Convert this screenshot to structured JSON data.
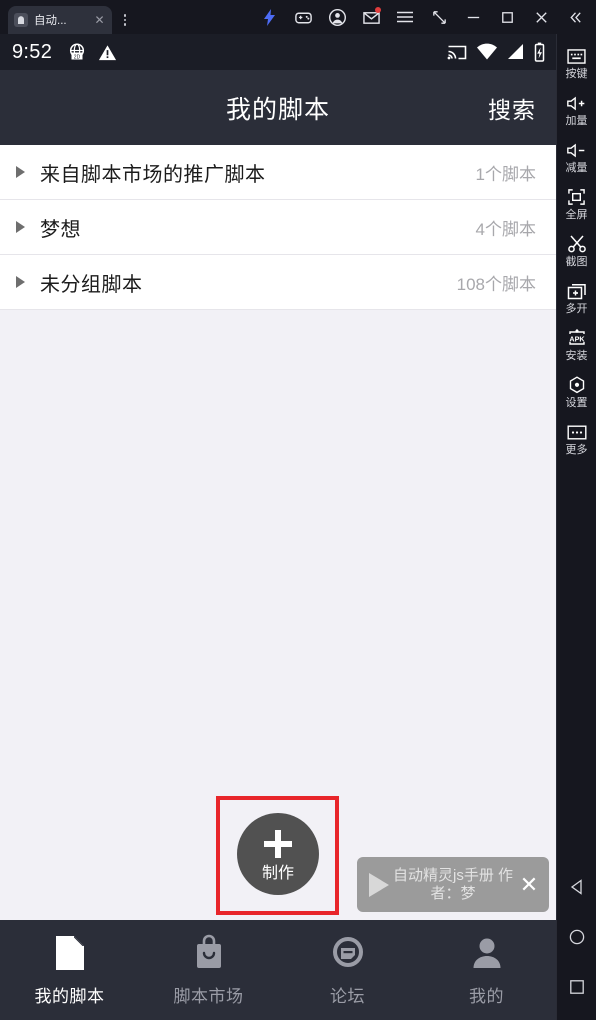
{
  "window": {
    "tab": {
      "title": "自动...",
      "icon": "app-favicon",
      "close_label": "✕"
    },
    "tab_menu_name": "tab-overflow-menu",
    "toolbar": [
      {
        "name": "boost-icon",
        "label": "加速"
      },
      {
        "name": "gamepad-icon",
        "label": "游戏手柄"
      },
      {
        "name": "account-icon",
        "label": "账号"
      },
      {
        "name": "mail-icon",
        "label": "消息",
        "badge": true
      },
      {
        "name": "menu-icon",
        "label": "菜单"
      },
      {
        "name": "resize-icon",
        "label": "调整大小"
      },
      {
        "name": "minimize-icon",
        "label": "最小化"
      },
      {
        "name": "maximize-icon",
        "label": "最大化"
      },
      {
        "name": "close-icon",
        "label": "关闭"
      },
      {
        "name": "collapse-icon",
        "label": "收起"
      }
    ]
  },
  "statusbar": {
    "time": "9:52",
    "left_icons": [
      "globe-2d-icon",
      "warning-triangle-icon"
    ],
    "right_icons": [
      "cast-icon",
      "wifi-icon",
      "signal-icon",
      "battery-charging-icon"
    ]
  },
  "header": {
    "title": "我的脚本",
    "search_label": "搜索"
  },
  "groups": [
    {
      "name": "来自脚本市场的推广脚本",
      "count": "1个脚本"
    },
    {
      "name": "梦想",
      "count": "4个脚本"
    },
    {
      "name": "未分组脚本",
      "count": "108个脚本"
    }
  ],
  "fab": {
    "label": "制作",
    "icon": "plus-icon",
    "highlight_color": "#e8252a",
    "background_color": "#515151"
  },
  "player": {
    "title": "自动精灵js手册 作者：梦",
    "play_icon": "play-icon",
    "close_label": "✕"
  },
  "bottom_nav": [
    {
      "label": "我的脚本",
      "icon": "document-icon",
      "active": true
    },
    {
      "label": "脚本市场",
      "icon": "shopping-bag-icon",
      "active": false
    },
    {
      "label": "论坛",
      "icon": "forum-icon",
      "active": false
    },
    {
      "label": "我的",
      "icon": "person-icon",
      "active": false
    }
  ],
  "sidebar": {
    "items": [
      {
        "label": "按键",
        "icon": "keyboard-icon"
      },
      {
        "label": "加量",
        "icon": "volume-up-icon"
      },
      {
        "label": "减量",
        "icon": "volume-down-icon"
      },
      {
        "label": "全屏",
        "icon": "fullscreen-icon"
      },
      {
        "label": "截图",
        "icon": "scissors-icon"
      },
      {
        "label": "多开",
        "icon": "multi-instance-icon"
      },
      {
        "label": "安装",
        "icon": "apk-install-icon"
      },
      {
        "label": "设置",
        "icon": "settings-icon"
      },
      {
        "label": "更多",
        "icon": "more-icon"
      }
    ],
    "nav": [
      {
        "name": "android-back-button"
      },
      {
        "name": "android-home-button"
      },
      {
        "name": "android-recents-button"
      }
    ]
  }
}
